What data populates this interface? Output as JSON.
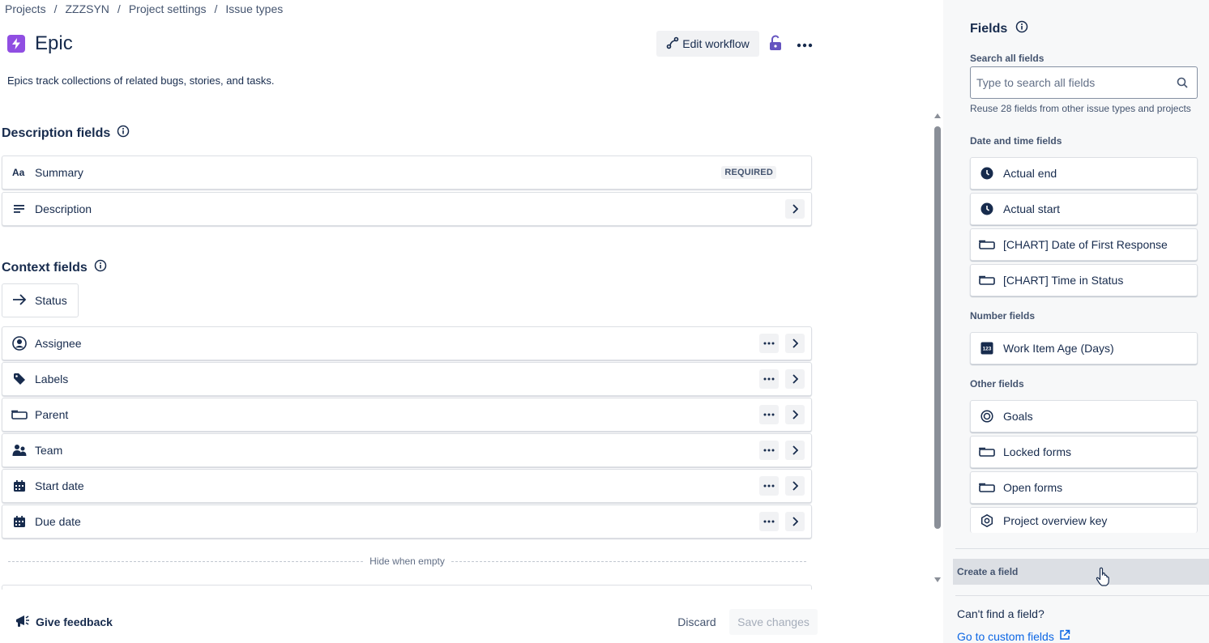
{
  "breadcrumb": {
    "items": [
      "Projects",
      "ZZZSYN",
      "Project settings",
      "Issue types"
    ],
    "separator": "/"
  },
  "header": {
    "title": "Epic",
    "icon": "epic-lightning-icon",
    "icon_color": "#904ee2",
    "edit_workflow_label": "Edit workflow",
    "description": "Epics track collections of related bugs, stories, and tasks."
  },
  "description_fields": {
    "title": "Description fields",
    "items": [
      {
        "label": "Summary",
        "icon": "text-format-icon",
        "badge": "REQUIRED"
      },
      {
        "label": "Description",
        "icon": "text-lines-icon"
      }
    ]
  },
  "context_fields": {
    "title": "Context fields",
    "status_label": "Status",
    "items": [
      {
        "label": "Assignee",
        "icon": "person-circle-icon"
      },
      {
        "label": "Labels",
        "icon": "tag-icon"
      },
      {
        "label": "Parent",
        "icon": "field-box-icon"
      },
      {
        "label": "Team",
        "icon": "people-icon"
      },
      {
        "label": "Start date",
        "icon": "calendar-icon"
      },
      {
        "label": "Due date",
        "icon": "calendar-icon"
      }
    ],
    "hide_when_empty": "Hide when empty"
  },
  "footer": {
    "feedback_label": "Give feedback",
    "discard_label": "Discard",
    "save_label": "Save changes"
  },
  "panel": {
    "title": "Fields",
    "search_label": "Search all fields",
    "search_placeholder": "Type to search all fields",
    "search_value": "",
    "helper": "Reuse 28 fields from other issue types and projects",
    "groups": [
      {
        "title": "Date and time fields",
        "items": [
          {
            "label": "Actual end",
            "icon": "clock-icon"
          },
          {
            "label": "Actual start",
            "icon": "clock-icon"
          },
          {
            "label": "[CHART] Date of First Response",
            "icon": "field-box-icon"
          },
          {
            "label": "[CHART] Time in Status",
            "icon": "field-box-icon"
          }
        ]
      },
      {
        "title": "Number fields",
        "items": [
          {
            "label": "Work Item Age (Days)",
            "icon": "number-123-icon"
          }
        ]
      },
      {
        "title": "Other fields",
        "items": [
          {
            "label": "Goals",
            "icon": "goal-target-icon"
          },
          {
            "label": "Locked forms",
            "icon": "field-box-icon"
          },
          {
            "label": "Open forms",
            "icon": "field-box-icon"
          },
          {
            "label": "Project overview key",
            "icon": "hexagon-key-icon"
          }
        ]
      }
    ],
    "create_field_label": "Create a field",
    "cant_find": "Can't find a field?",
    "custom_fields_link": "Go to custom fields"
  },
  "colors": {
    "link": "#0c66e4",
    "text": "#172b4d",
    "lock_icon": "#6554c0"
  }
}
